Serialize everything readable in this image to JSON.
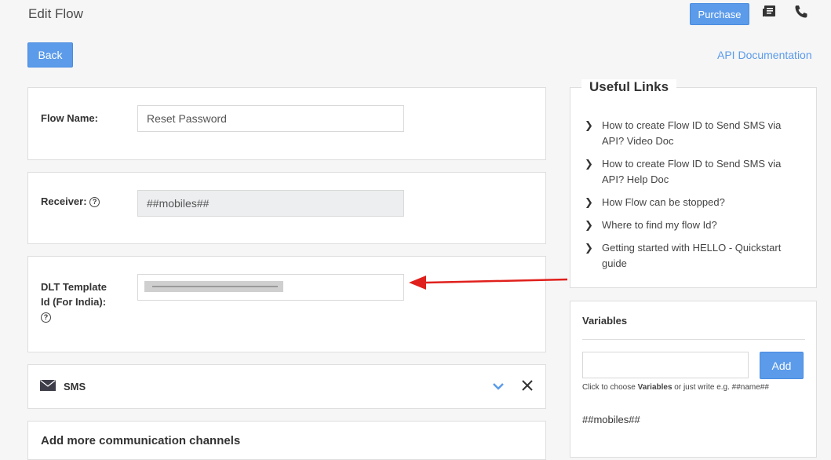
{
  "header": {
    "title": "Edit Flow",
    "purchase_label": "Purchase",
    "back_label": "Back",
    "api_doc_label": "API Documentation"
  },
  "form": {
    "flow_name_label": "Flow Name:",
    "flow_name_value": "Reset Password",
    "receiver_label": "Receiver:",
    "receiver_value": "##mobiles##",
    "dlt_label_line1": "DLT Template",
    "dlt_label_line2": "Id (For India):"
  },
  "sms": {
    "label": "SMS"
  },
  "channels": {
    "title": "Add more communication channels"
  },
  "useful_links": {
    "title": "Useful Links",
    "items": [
      {
        "line1": "How to create Flow ID to Send SMS via",
        "line2": "API? Video Doc"
      },
      {
        "line1": "How to create Flow ID to Send SMS via",
        "line2": "API? Help Doc"
      },
      {
        "line1": "How Flow can be stopped?",
        "line2": ""
      },
      {
        "line1": "Where to find my flow Id?",
        "line2": ""
      },
      {
        "line1": "Getting started with HELLO - Quickstart",
        "line2": "guide"
      }
    ]
  },
  "variables": {
    "title": "Variables",
    "add_label": "Add",
    "hint_prefix": "Click to choose ",
    "hint_bold": "Variables",
    "hint_suffix": " or just write e.g. ##name##",
    "items": [
      "##mobiles##"
    ]
  },
  "colors": {
    "accent": "#5b9bea",
    "arrow": "#e0201c"
  }
}
